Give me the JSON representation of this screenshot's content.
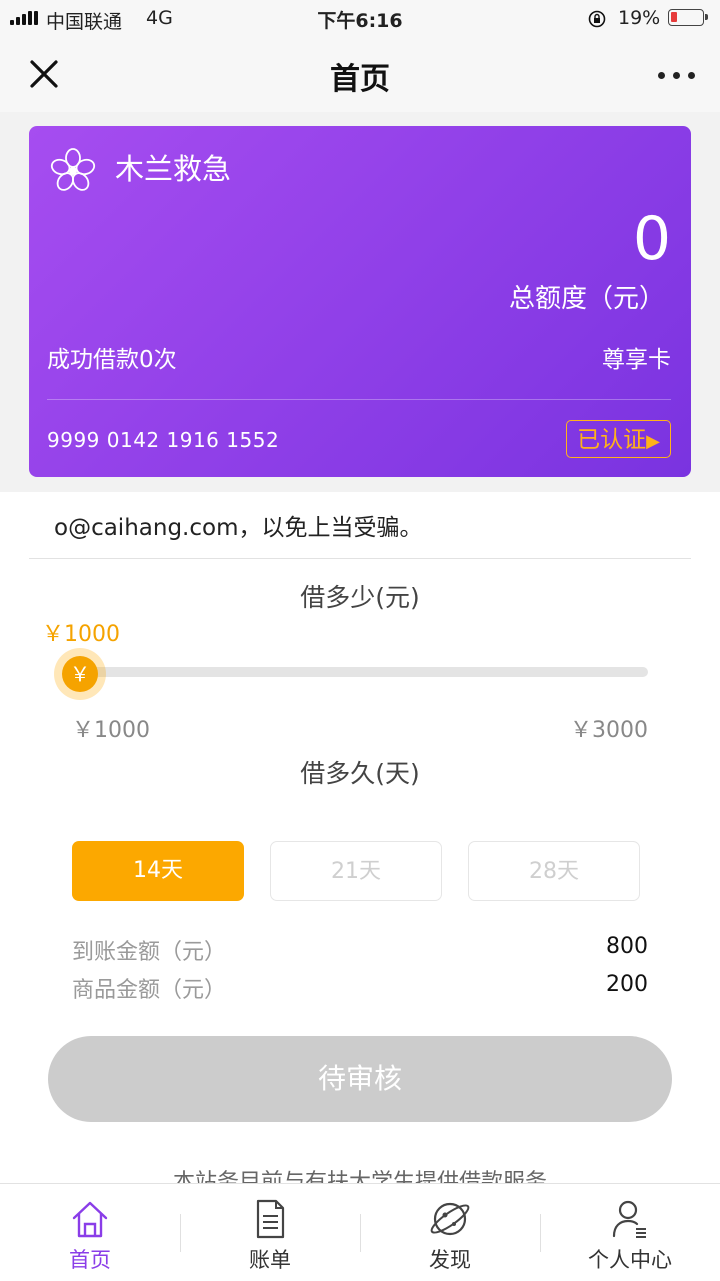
{
  "status_bar": {
    "carrier": "中国联通",
    "network": "4G",
    "time": "下午6:16",
    "battery": "19%",
    "battery_level": 0.19
  },
  "nav": {
    "title": "首页",
    "close_icon": "close-icon",
    "more_icon": "more-icon"
  },
  "card": {
    "brand": "木兰救急",
    "limit_value": "0",
    "limit_label": "总额度（元）",
    "loan_count": "成功借款0次",
    "card_type": "尊享卡",
    "card_number": "9999 0142 1916 1552",
    "verified": "已认证",
    "gradient_start": "#a64df0",
    "gradient_end": "#7a33e0",
    "badge_color": "#ffb21a"
  },
  "notice": "o@caihang.com，以免上当受骗。",
  "loan_amount": {
    "title": "借多少(元)",
    "current": "￥1000",
    "thumb_symbol": "￥",
    "min_label": "￥1000",
    "max_label": "￥3000",
    "min": 1000,
    "max": 3000,
    "value": 1000
  },
  "loan_duration": {
    "title": "借多久(天)",
    "options": [
      {
        "label": "14天",
        "selected": true
      },
      {
        "label": "21天",
        "selected": false
      },
      {
        "label": "28天",
        "selected": false
      }
    ]
  },
  "summary": {
    "received_label": "到账金额（元）",
    "received_value": "800",
    "goods_label": "商品金额（元）",
    "goods_value": "200"
  },
  "submit_label": "待审核",
  "footer_partial": "本站务目前与有扶大学生提供借款服务",
  "tabs": [
    {
      "label": "首页",
      "icon": "home-icon",
      "active": true
    },
    {
      "label": "账单",
      "icon": "bill-icon",
      "active": false
    },
    {
      "label": "发现",
      "icon": "discover-icon",
      "active": false
    },
    {
      "label": "个人中心",
      "icon": "user-icon",
      "active": false
    }
  ],
  "colors": {
    "accent": "#fca800",
    "purple": "#8a3de8",
    "disabled_button": "#cccccc"
  }
}
